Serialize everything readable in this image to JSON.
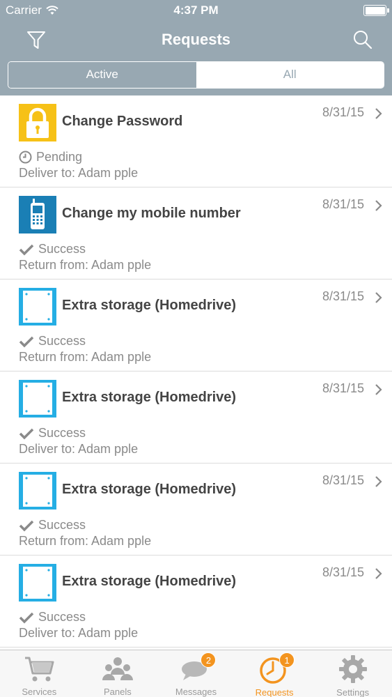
{
  "status_bar": {
    "carrier": "Carrier",
    "time": "4:37 PM"
  },
  "nav": {
    "title": "Requests",
    "filter_icon": "filter-icon",
    "search_icon": "search-icon"
  },
  "segmented": {
    "options": [
      "Active",
      "All"
    ],
    "selected": "Active"
  },
  "requests": [
    {
      "icon": "lock-icon",
      "title": "Change Password",
      "date": "8/31/15",
      "status": "Pending",
      "status_icon": "clock-icon",
      "detail": "Deliver to: Adam pple"
    },
    {
      "icon": "mobile-phone-icon",
      "title": "Change my mobile number",
      "date": "8/31/15",
      "status": "Success",
      "status_icon": "checkmark-icon",
      "detail": "Return from: Adam pple"
    },
    {
      "icon": "storage-drive-icon",
      "title": "Extra storage (Homedrive)",
      "date": "8/31/15",
      "status": "Success",
      "status_icon": "checkmark-icon",
      "detail": "Return from: Adam pple"
    },
    {
      "icon": "storage-drive-icon",
      "title": "Extra storage (Homedrive)",
      "date": "8/31/15",
      "status": "Success",
      "status_icon": "checkmark-icon",
      "detail": "Deliver to: Adam pple"
    },
    {
      "icon": "storage-drive-icon",
      "title": "Extra storage (Homedrive)",
      "date": "8/31/15",
      "status": "Success",
      "status_icon": "checkmark-icon",
      "detail": "Return from: Adam pple"
    },
    {
      "icon": "storage-drive-icon",
      "title": "Extra storage (Homedrive)",
      "date": "8/31/15",
      "status": "Success",
      "status_icon": "checkmark-icon",
      "detail": "Deliver to: Adam pple"
    }
  ],
  "tabbar": [
    {
      "label": "Services",
      "icon": "cart-icon",
      "badge": null,
      "selected": false
    },
    {
      "label": "Panels",
      "icon": "people-icon",
      "badge": null,
      "selected": false
    },
    {
      "label": "Messages",
      "icon": "chat-bubble-icon",
      "badge": "2",
      "selected": false
    },
    {
      "label": "Requests",
      "icon": "clock-icon",
      "badge": "1",
      "selected": true
    },
    {
      "label": "Settings",
      "icon": "gear-icon",
      "badge": null,
      "selected": false
    }
  ],
  "colors": {
    "header": "#98a8b2",
    "accent": "#f3941f",
    "lock_tile": "#f6c117",
    "phone_tile": "#1a7fb5",
    "drive_tile": "#25aee4"
  }
}
